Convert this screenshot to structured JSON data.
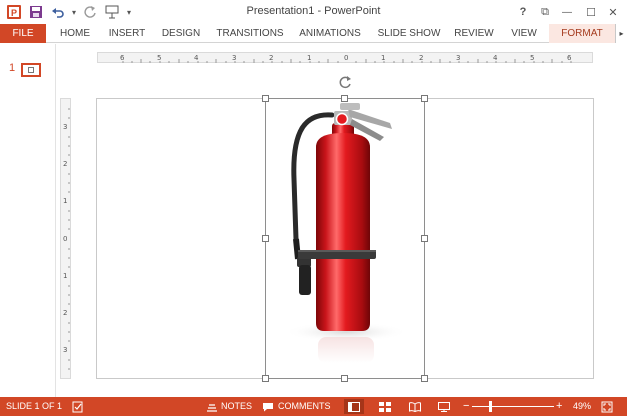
{
  "window": {
    "title": "Presentation1 - PowerPoint",
    "help_glyph": "?",
    "restore_glyph": "⧉",
    "minimize_glyph": "—",
    "maximize_glyph": "☐",
    "close_glyph": "✕"
  },
  "quick_access": {
    "dropdown_glyph": "▾"
  },
  "ribbon": {
    "tabs": [
      {
        "label": "FILE"
      },
      {
        "label": "HOME"
      },
      {
        "label": "INSERT"
      },
      {
        "label": "DESIGN"
      },
      {
        "label": "TRANSITIONS"
      },
      {
        "label": "ANIMATIONS"
      },
      {
        "label": "SLIDE SHOW"
      },
      {
        "label": "REVIEW"
      },
      {
        "label": "VIEW"
      },
      {
        "label": "FORMAT"
      }
    ],
    "scroll_glyph": "▸"
  },
  "thumbnails": {
    "slide_number": "1"
  },
  "rulers": {
    "horizontal_labels": [
      "6",
      "5",
      "4",
      "3",
      "2",
      "1",
      "0",
      "1",
      "2",
      "3",
      "4",
      "5",
      "6"
    ],
    "vertical_labels": [
      "3",
      "2",
      "1",
      "0",
      "1",
      "2",
      "3"
    ]
  },
  "status": {
    "slide_indicator": "SLIDE 1 OF 1",
    "notes_label": "NOTES",
    "comments_label": "COMMENTS",
    "zoom_minus": "−",
    "zoom_plus": "+",
    "zoom_level": "49%",
    "zoom_fraction": 0.49
  },
  "colors": {
    "accent": "#d24726",
    "format_tab_bg": "#fbe7e1",
    "extinguisher_red": "#d9181c"
  },
  "icons": {
    "app": "powerpoint-icon",
    "save": "save-icon",
    "undo": "undo-icon",
    "redo": "redo-icon",
    "start_slideshow": "presenter-icon",
    "spell": "spelling-icon",
    "notes": "notes-icon",
    "comments": "comment-icon",
    "normal_view": "normal-view-icon",
    "sorter_view": "slide-sorter-icon",
    "reading_view": "reading-view-icon",
    "slideshow_view": "slideshow-view-icon",
    "fit": "fit-to-window-icon",
    "rotate": "rotate-handle-icon"
  }
}
